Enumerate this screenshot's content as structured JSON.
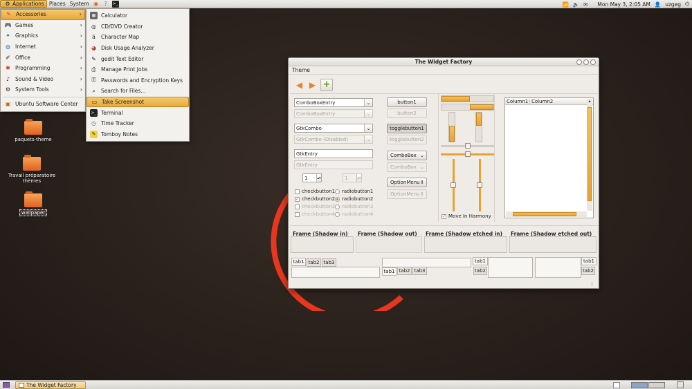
{
  "top_panel": {
    "menus": [
      "Applications",
      "Places",
      "System"
    ],
    "clock": "Mon May  3,  2:05 AM",
    "user": "uzgeg"
  },
  "app_menu": {
    "categories": [
      "Accessories",
      "Games",
      "Graphics",
      "Internet",
      "Office",
      "Programming",
      "Sound & Video",
      "System Tools"
    ],
    "footer_item": "Ubuntu Software Center"
  },
  "accessories_menu": {
    "items": [
      "Calculator",
      "CD/DVD Creator",
      "Character Map",
      "Disk Usage Analyzer",
      "gedit Text Editor",
      "Manage Print Jobs",
      "Passwords and Encryption Keys",
      "Search for Files...",
      "Take Screenshot",
      "Terminal",
      "Time Tracker",
      "Tomboy Notes"
    ]
  },
  "desktop": {
    "icons": [
      "paquets-theme",
      "Travail préparatoire thèmes",
      "wallpaper"
    ]
  },
  "window": {
    "title": "The Widget Factory",
    "menu": "Theme",
    "combos": {
      "c1": "ComboBoxEntry",
      "c2": "ComboBoxEntry",
      "c3": "GtkCombo",
      "c4": "GtkCombo (Disabled)",
      "e1": "GtkEntry",
      "e2": "GtkEntry",
      "spin1": "1",
      "spin2": "1"
    },
    "checks": [
      "checkbutton1",
      "checkbutton2",
      "checkbutton3",
      "checkbutton4"
    ],
    "radios": [
      "radiobutton1",
      "radiobutton2",
      "radiobutton3",
      "radiobutton4"
    ],
    "buttons": {
      "b1": "button1",
      "b2": "button2",
      "t1": "togglebutton1",
      "t2": "togglebutton2",
      "cb1": "ComboBox",
      "cb2": "ComboBox",
      "om1": "OptionMenu",
      "om2": "OptionMenu"
    },
    "move_harmony": "Move In Harmony",
    "columns": [
      "Column1",
      "Column2"
    ],
    "frames": [
      "Frame (Shadow in)",
      "Frame (Shadow out)",
      "Frame (Shadow etched in)",
      "Frame (Shadow etched out)"
    ],
    "tabs": [
      "tab1",
      "tab2",
      "tab3"
    ],
    "levels": {
      "hbar1": 0.55,
      "hbar2": 0.45,
      "vbar1": 0.55,
      "vbar2": 0.45,
      "hscale1": 0.5,
      "hscale2": 0.5,
      "vscale1": 0.5,
      "vscale2": 0.5
    }
  },
  "taskbar": {
    "window_button": "The Widget Factory"
  }
}
